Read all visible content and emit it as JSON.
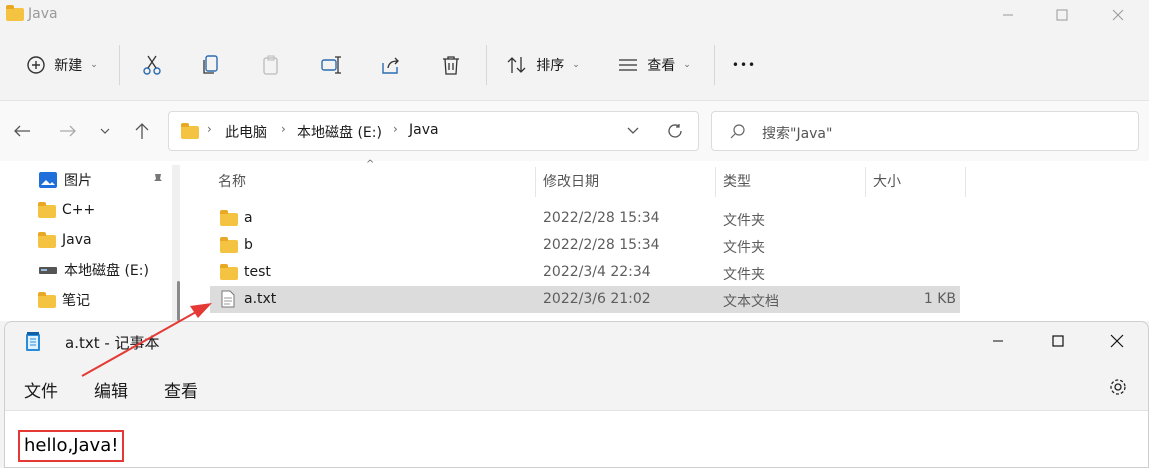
{
  "explorer": {
    "title": "Java",
    "toolbar": {
      "new_label": "新建",
      "sort_label": "排序",
      "view_label": "查看",
      "more_label": "•••"
    },
    "breadcrumb": [
      "此电脑",
      "本地磁盘 (E:)",
      "Java"
    ],
    "search_placeholder": "搜索\"Java\"",
    "sidebar": [
      {
        "label": "图片",
        "icon": "pictures-icon"
      },
      {
        "label": "C++",
        "icon": "folder-icon"
      },
      {
        "label": "Java",
        "icon": "folder-icon"
      },
      {
        "label": "本地磁盘 (E:)",
        "icon": "drive-icon"
      },
      {
        "label": "笔记",
        "icon": "folder-icon"
      }
    ],
    "columns": {
      "name": "名称",
      "modified": "修改日期",
      "type": "类型",
      "size": "大小"
    },
    "files": [
      {
        "name": "a",
        "modified": "2022/2/28 15:34",
        "type": "文件夹",
        "size": "",
        "icon": "folder-icon"
      },
      {
        "name": "b",
        "modified": "2022/2/28 15:34",
        "type": "文件夹",
        "size": "",
        "icon": "folder-icon"
      },
      {
        "name": "test",
        "modified": "2022/3/4 22:34",
        "type": "文件夹",
        "size": "",
        "icon": "folder-icon"
      },
      {
        "name": "a.txt",
        "modified": "2022/3/6 21:02",
        "type": "文本文档",
        "size": "1 KB",
        "icon": "text-file-icon"
      }
    ]
  },
  "notepad": {
    "title": "a.txt - 记事本",
    "menu": [
      "文件",
      "编辑",
      "查看"
    ],
    "content": "hello,Java!"
  },
  "colors": {
    "annotation_red": "#e53935",
    "folder_yellow": "#f5c342"
  }
}
